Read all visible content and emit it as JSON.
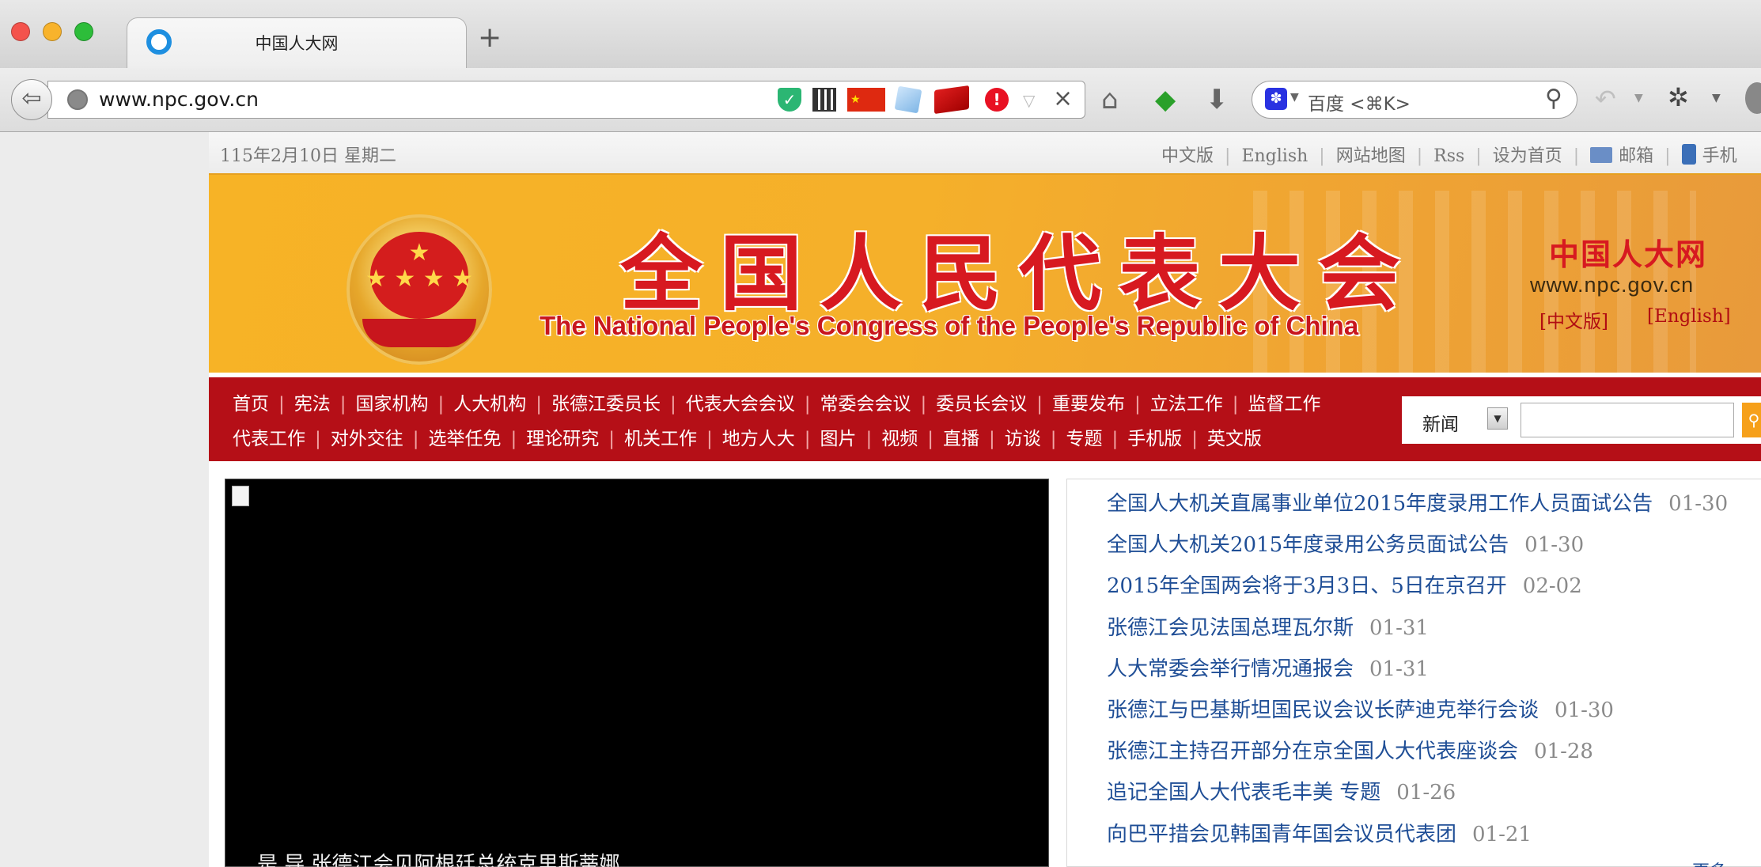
{
  "browser": {
    "tab_title": "中国人大网",
    "new_tab_label": "+",
    "url": "www.npc.gov.cn",
    "search_placeholder": "百度 <⌘K>",
    "toolbar_icons": [
      "home-icon",
      "frog-icon",
      "download-icon",
      "undo-icon",
      "bug-icon",
      "user-icon"
    ]
  },
  "util_bar": {
    "date": "115年2月10日  星期二",
    "links": [
      "中文版",
      "English",
      "网站地图",
      "Rss",
      "设为首页",
      "邮箱",
      "手机"
    ]
  },
  "banner": {
    "cn_title": "全国人民代表大会",
    "en_title": "The National People's Congress of the People's Republic of China",
    "site_name": "中国人大网",
    "site_url": "www.npc.gov.cn",
    "lang_cn": "[中文版]",
    "lang_en": "[English]"
  },
  "nav": {
    "row1": [
      "首页",
      "宪法",
      "国家机构",
      "人大机构",
      "张德江委员长",
      "代表大会会议",
      "常委会会议",
      "委员长会议",
      "重要发布",
      "立法工作",
      "监督工作"
    ],
    "row2": [
      "代表工作",
      "对外交往",
      "选举任免",
      "理论研究",
      "机关工作",
      "地方人大",
      "图片",
      "视频",
      "直播",
      "访谈",
      "专题",
      "手机版",
      "英文版"
    ]
  },
  "site_search": {
    "category": "新闻",
    "value": ""
  },
  "video": {
    "caption": "是 导 张德江会见阿根廷总统克里斯蒂娜"
  },
  "news": [
    {
      "title": "全国人大机关直属事业单位2015年度录用工作人员面试公告",
      "date": "01-30"
    },
    {
      "title": "全国人大机关2015年度录用公务员面试公告",
      "date": "01-30"
    },
    {
      "title": "2015年全国两会将于3月3日、5日在京召开",
      "date": "02-02"
    },
    {
      "title": "张德江会见法国总理瓦尔斯",
      "date": "01-31"
    },
    {
      "title": "人大常委会举行情况通报会",
      "date": "01-31"
    },
    {
      "title": "张德江与巴基斯坦国民议会议长萨迪克举行会谈",
      "date": "01-30"
    },
    {
      "title": "张德江主持召开部分在京全国人大代表座谈会",
      "date": "01-28"
    },
    {
      "title": "追记全国人大代表毛丰美  专题",
      "date": "01-26"
    },
    {
      "title": "向巴平措会见韩国青年国会议员代表团",
      "date": "01-21"
    }
  ],
  "more_label": "更多>>"
}
